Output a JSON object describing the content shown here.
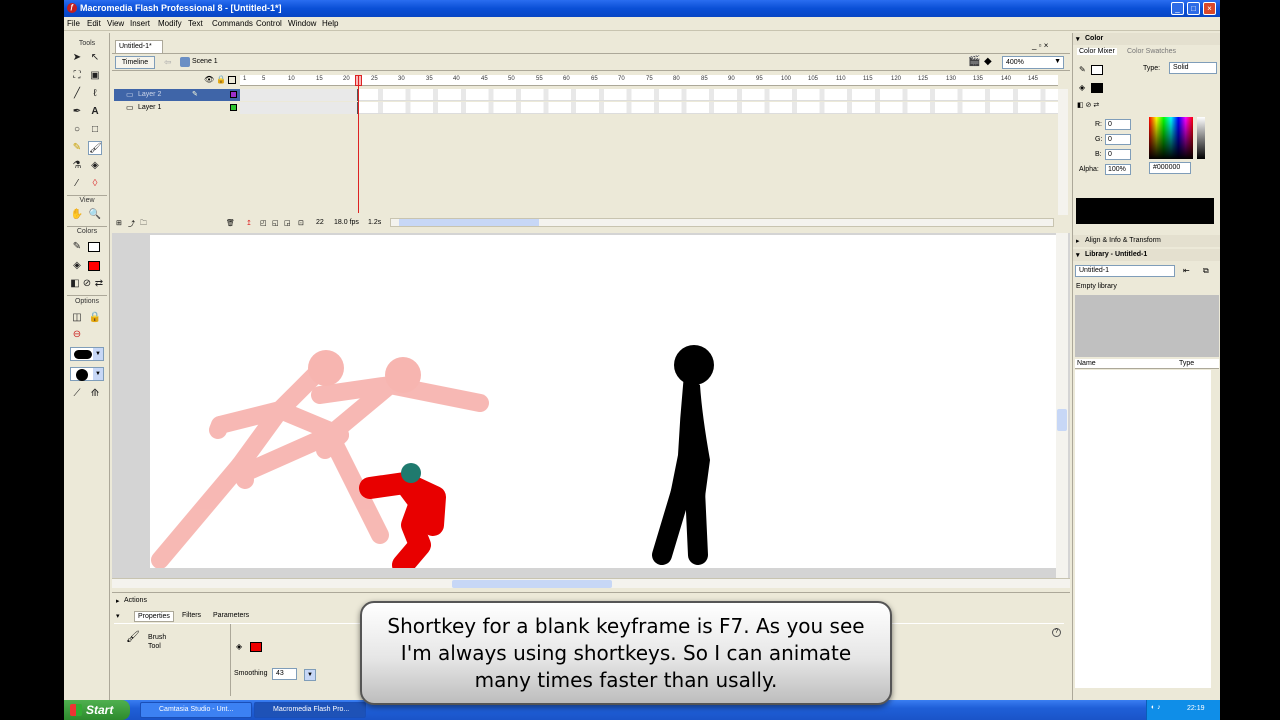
{
  "window": {
    "title": "Macromedia Flash Professional 8 - [Untitled-1*]"
  },
  "menu": [
    "File",
    "Edit",
    "View",
    "Insert",
    "Modify",
    "Text",
    "Commands",
    "Control",
    "Window",
    "Help"
  ],
  "tools": {
    "header": "Tools",
    "view_label": "View",
    "colors_label": "Colors",
    "options_label": "Options",
    "fill_color": "#ff0000",
    "stroke_color": "#000000"
  },
  "document": {
    "tab": "Untitled-1*",
    "timeline_button": "Timeline",
    "scene": "Scene 1",
    "zoom": "400%"
  },
  "timeline": {
    "ruler_ticks": [
      "1",
      "5",
      "10",
      "15",
      "20",
      "25",
      "30",
      "35",
      "40",
      "45",
      "50",
      "55",
      "60",
      "65",
      "70",
      "75",
      "80",
      "85",
      "90",
      "95",
      "100",
      "105",
      "110",
      "115",
      "120",
      "125",
      "130",
      "135",
      "140",
      "145"
    ],
    "layers": [
      {
        "name": "Layer 2",
        "selected": true,
        "color": "#9b30c9"
      },
      {
        "name": "Layer 1",
        "selected": false,
        "color": "#2ec42e"
      }
    ],
    "current_frame": "22",
    "fps": "18.0 fps",
    "elapsed": "1.2s"
  },
  "bottom": {
    "actions_label": "Actions",
    "tabs": [
      "Properties",
      "Filters",
      "Parameters"
    ],
    "tool_name_line1": "Brush",
    "tool_name_line2": "Tool",
    "smoothing_label": "Smoothing",
    "smoothing_value": "43"
  },
  "color_panel": {
    "title": "Color",
    "tabs": [
      "Color Mixer",
      "Color Swatches"
    ],
    "type_label": "Type:",
    "type_value": "Solid",
    "r_label": "R:",
    "r": "0",
    "g_label": "G:",
    "g": "0",
    "b_label": "B:",
    "b": "0",
    "alpha_label": "Alpha:",
    "alpha": "100%",
    "hex": "#000000"
  },
  "align_panel": {
    "title": "Align & Info & Transform"
  },
  "library": {
    "title": "Library - Untitled-1",
    "document": "Untitled-1",
    "status": "Empty library",
    "col_name": "Name",
    "col_type": "Type"
  },
  "taskbar": {
    "start": "Start",
    "tasks": [
      "Camtasia Studio - Unt...",
      "Macromedia Flash Pro..."
    ],
    "clock": "22:19"
  },
  "caption": {
    "line1": "Shortkey for a blank keyframe is F7. As you see",
    "line2": "I'm always using shortkeys. So I can animate",
    "line3": "many times faster than usally."
  }
}
